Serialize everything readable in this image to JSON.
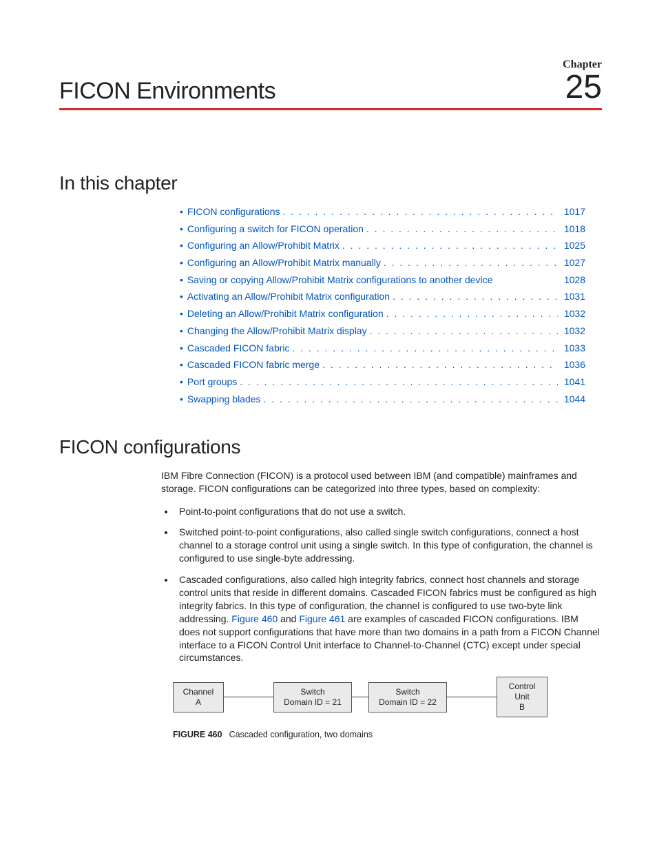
{
  "chapter": {
    "label": "Chapter",
    "number": "25",
    "title": "FICON Environments"
  },
  "section1": {
    "heading": "In this chapter",
    "toc": [
      {
        "label": "FICON configurations",
        "page": "1017",
        "dots": true
      },
      {
        "label": "Configuring a switch for FICON operation",
        "page": "1018",
        "dots": true
      },
      {
        "label": "Configuring an Allow/Prohibit Matrix",
        "page": "1025",
        "dots": true
      },
      {
        "label": "Configuring an Allow/Prohibit Matrix manually",
        "page": "1027",
        "dots": true
      },
      {
        "label": "Saving or copying Allow/Prohibit Matrix configurations to another device",
        "page": "1028",
        "dots": false
      },
      {
        "label": "Activating an Allow/Prohibit Matrix configuration",
        "page": "1031",
        "dots": true
      },
      {
        "label": "Deleting an Allow/Prohibit Matrix configuration",
        "page": "1032",
        "dots": true
      },
      {
        "label": "Changing the Allow/Prohibit Matrix display",
        "page": "1032",
        "dots": true
      },
      {
        "label": "Cascaded FICON fabric",
        "page": "1033",
        "dots": true
      },
      {
        "label": "Cascaded FICON fabric merge",
        "page": "1036",
        "dots": true
      },
      {
        "label": "Port groups",
        "page": "1041",
        "dots": true
      },
      {
        "label": "Swapping blades",
        "page": "1044",
        "dots": true
      }
    ]
  },
  "section2": {
    "heading": "FICON configurations",
    "intro": "IBM Fibre Connection (FICON) is a protocol used between IBM (and compatible) mainframes and storage. FICON configurations can be categorized into three types, based on complexity:",
    "bullets": {
      "b1": "Point-to-point configurations that do not use a switch.",
      "b2": "Switched point-to-point configurations, also called single switch configurations, connect a host channel to a storage control unit using a single switch. In this type of configuration, the channel is configured to use single-byte addressing.",
      "b3_a": "Cascaded configurations, also called high integrity fabrics, connect host channels and storage control units that reside in different domains. Cascaded FICON fabrics must be configured as high integrity fabrics. In this type of configuration, the channel is configured to use two-byte link addressing. ",
      "b3_fig460": "Figure 460",
      "b3_and": " and ",
      "b3_fig461": "Figure 461",
      "b3_b": " are examples of cascaded FICON configurations. IBM does not support configurations that have more than two domains in a path from a FICON Channel interface to a FICON Control Unit interface to Channel-to-Channel (CTC) except under special circumstances."
    }
  },
  "diagram": {
    "box1_l1": "Channel",
    "box1_l2": "A",
    "box2_l1": "Switch",
    "box2_l2": "Domain ID = 21",
    "box3_l1": "Switch",
    "box3_l2": "Domain ID = 22",
    "box4_l1": "Control",
    "box4_l2": "Unit",
    "box4_l3": "B"
  },
  "figure": {
    "num": "FIGURE 460",
    "caption": "Cascaded configuration, two domains"
  }
}
